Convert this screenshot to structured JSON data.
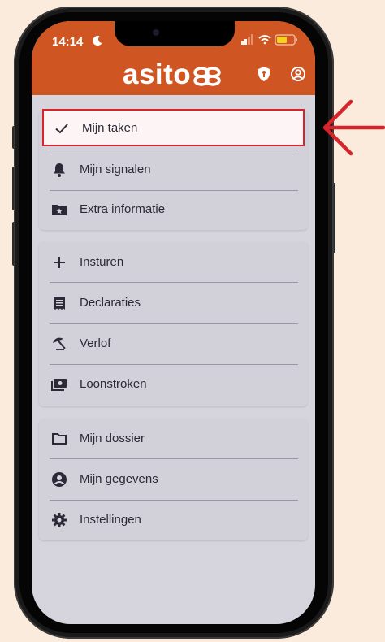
{
  "status_bar": {
    "time": "14:14"
  },
  "header": {
    "logo_text": "asito"
  },
  "menu": {
    "selected": {
      "label": "Mijn taken",
      "icon": "check-icon"
    },
    "group1": [
      {
        "label": "Mijn signalen",
        "icon": "bell-icon"
      },
      {
        "label": "Extra informatie",
        "icon": "folder-star-icon"
      }
    ],
    "group2": [
      {
        "label": "Insturen",
        "icon": "plus-icon"
      },
      {
        "label": "Declaraties",
        "icon": "receipt-icon"
      },
      {
        "label": "Verlof",
        "icon": "beach-umbrella-icon"
      },
      {
        "label": "Loonstroken",
        "icon": "money-icon"
      }
    ],
    "group3": [
      {
        "label": "Mijn dossier",
        "icon": "folder-icon"
      },
      {
        "label": "Mijn gegevens",
        "icon": "account-circle-icon"
      },
      {
        "label": "Instellingen",
        "icon": "gear-icon"
      }
    ]
  },
  "colors": {
    "background": "#FBEBDC",
    "header": "#CF5523",
    "highlight_border": "#D9232A",
    "arrow": "#D9232A",
    "menu_bg": "#D6D4DC"
  }
}
